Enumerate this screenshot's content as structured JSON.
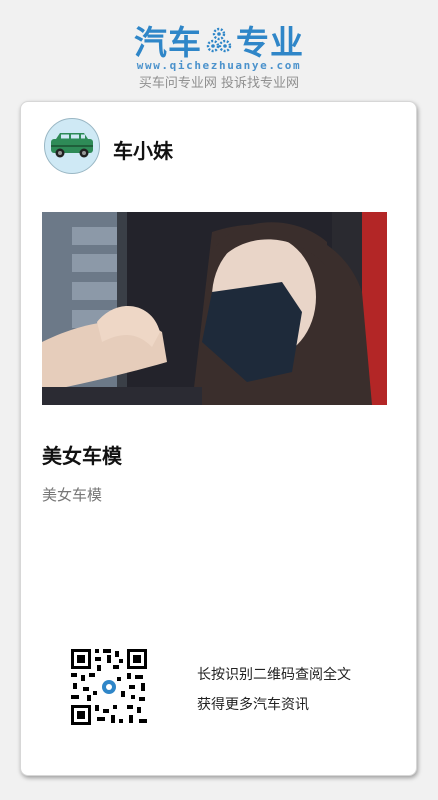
{
  "header": {
    "logo_left": "汽车",
    "logo_right": "专业",
    "logo_icon": "gear-icon",
    "url": "www.qichezhuanye.com",
    "slogan": "买车问专业网 投诉找专业网"
  },
  "card": {
    "author_name": "车小妹",
    "avatar_icon": "car-icon",
    "article_title": "美女车模",
    "article_summary": "美女车模",
    "qr_line1": "长按识别二维码查阅全文",
    "qr_line2": "获得更多汽车资讯"
  },
  "colors": {
    "brand_blue": "#2f86c8",
    "page_bg": "#f1f1f1",
    "card_bg": "#ffffff"
  }
}
